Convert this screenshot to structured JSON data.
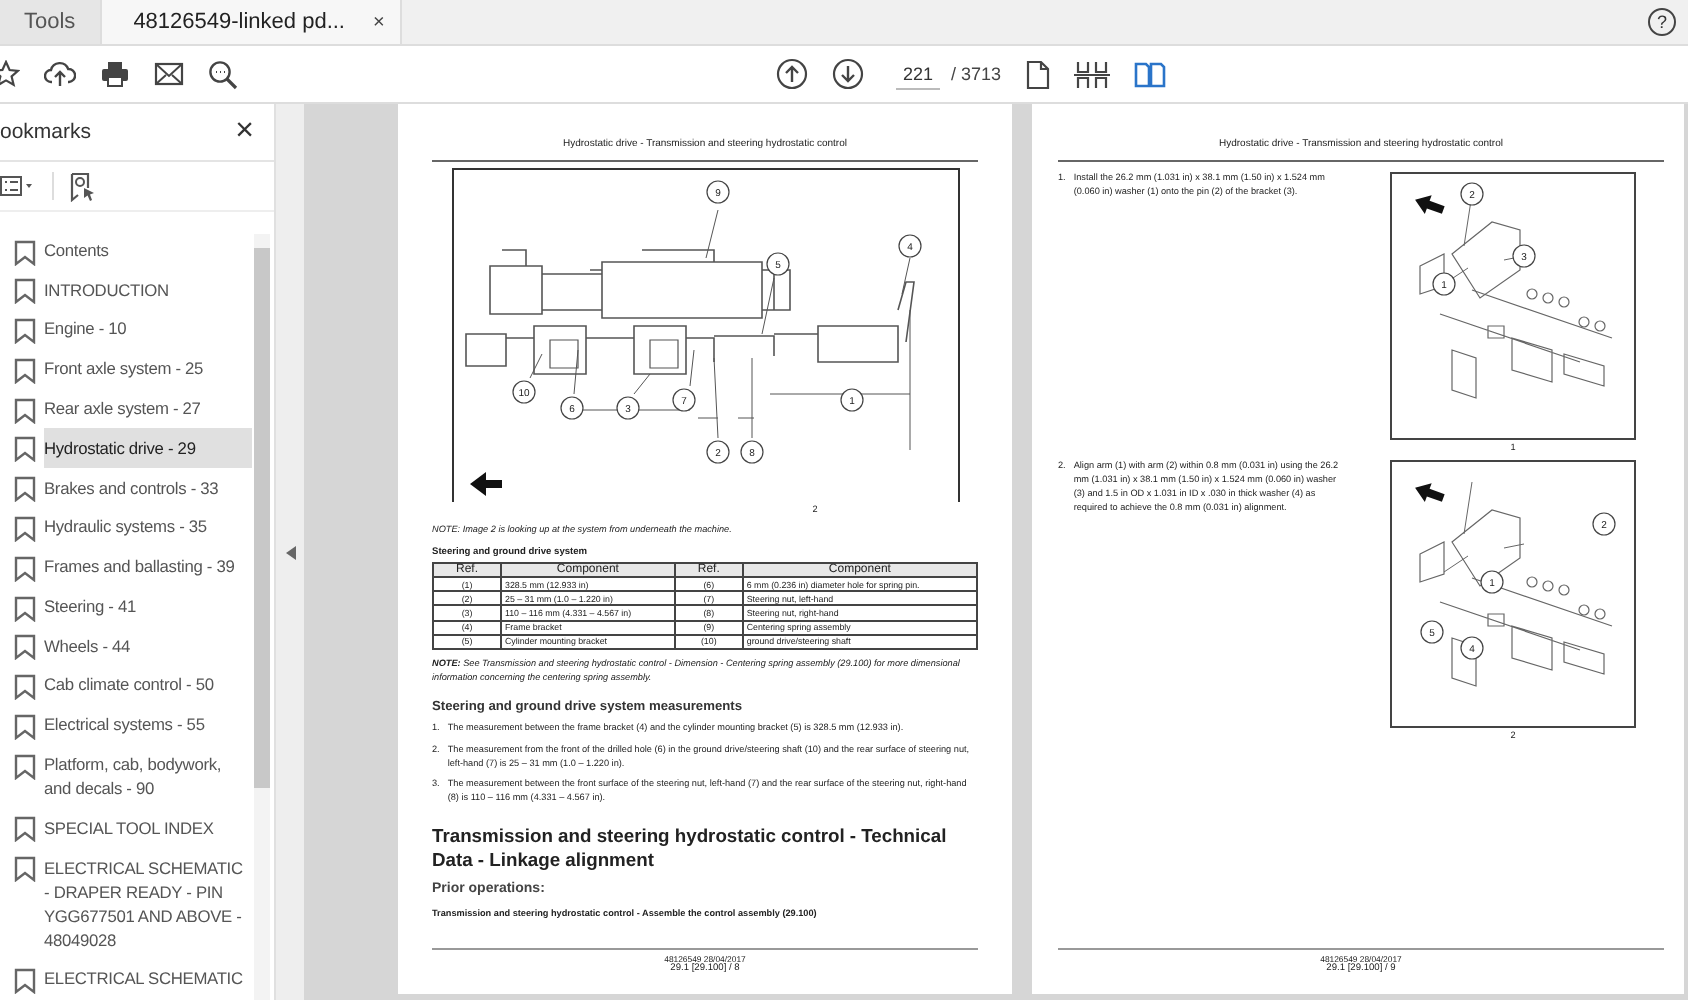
{
  "tabs": [
    {
      "label": "Tools",
      "selected": false
    },
    {
      "label": "48126549-linked pd...",
      "selected": true,
      "close": "×"
    }
  ],
  "help": "?",
  "toolbar": {
    "page_current": "221",
    "page_total": "/ 3713",
    "two_page_view": true
  },
  "bookmarks": {
    "title": "ookmarks",
    "close": "×",
    "items": [
      {
        "label": "Contents",
        "selected": false
      },
      {
        "label": "INTRODUCTION",
        "selected": false
      },
      {
        "label": "Engine - 10",
        "selected": false
      },
      {
        "label": "Front axle system - 25",
        "selected": false
      },
      {
        "label": "Rear axle system - 27",
        "selected": false
      },
      {
        "label": "Hydrostatic drive - 29",
        "selected": true
      },
      {
        "label": "Brakes and controls - 33",
        "selected": false
      },
      {
        "label": "Hydraulic systems - 35",
        "selected": false
      },
      {
        "label": "Frames and ballasting - 39",
        "selected": false
      },
      {
        "label": "Steering - 41",
        "selected": false
      },
      {
        "label": "Wheels - 44",
        "selected": false
      },
      {
        "label": "Cab climate control - 50",
        "selected": false
      },
      {
        "label": "Electrical systems - 55",
        "selected": false
      },
      {
        "label": "Platform, cab, bodywork, and decals - 90",
        "selected": false
      },
      {
        "label": "SPECIAL TOOL INDEX",
        "selected": false
      },
      {
        "label": "ELECTRICAL SCHEMATIC - DRAPER READY - PIN YGG677501 AND ABOVE - 48049028",
        "selected": false
      },
      {
        "label": "ELECTRICAL SCHEMATIC",
        "selected": false
      }
    ]
  },
  "left_page": {
    "header": "Hydrostatic drive - Transmission and steering hydrostatic control",
    "figure": {
      "caption": "2",
      "callouts": [
        "9",
        "5",
        "4",
        "10",
        "6",
        "3",
        "7",
        "1",
        "2",
        "8"
      ]
    },
    "note": "NOTE: Image 2 is looking up at the system from underneath the machine.",
    "table_title": "Steering and ground drive system",
    "table": {
      "columns": [
        "Ref.",
        "Component",
        "Ref.",
        "Component"
      ],
      "rows": [
        [
          "(1)",
          "328.5 mm (12.933 in)",
          "(6)",
          "6 mm (0.236 in) diameter hole for spring pin."
        ],
        [
          "(2)",
          "25 – 31 mm (1.0 – 1.220 in)",
          "(7)",
          "Steering nut, left-hand"
        ],
        [
          "(3)",
          "110 – 116 mm (4.331 – 4.567 in)",
          "(8)",
          "Steering nut, right-hand"
        ],
        [
          "(4)",
          "Frame bracket",
          "(9)",
          "Centering spring assembly"
        ],
        [
          "(5)",
          "Cylinder mounting bracket",
          "(10)",
          "ground drive/steering shaft"
        ]
      ]
    },
    "note_2": "**NOTE:** See Transmission and steering hydrostatic control - Dimension - Centering spring assembly (29.100) for more dimensional information concerning the centering spring assembly.",
    "section_heading": "Steering and ground drive system measurements",
    "measurements": [
      {
        "number": "1.",
        "text": "The measurement between the frame bracket (4) and the cylinder mounting bracket (5) is 328.5 mm (12.933 in)."
      },
      {
        "number": "2.",
        "text": "The measurement from the front of the drilled hole (6) in the ground drive/steering shaft (10) and the rear surface of steering nut, left-hand (7) is 25 – 31 mm (1.0 – 1.220 in)."
      },
      {
        "number": "3.",
        "text": "The measurement between the front surface of the steering nut, left-hand (7) and the rear surface of the steering nut, right-hand (8) is 110 – 116 mm (4.331 – 4.567 in)."
      }
    ],
    "main_heading": "Transmission and steering hydrostatic control - Technical Data - Linkage alignment",
    "sub_heading": "Prior operations:",
    "prior_operation": "Transmission and steering hydrostatic control - Assemble the control assembly (29.100)",
    "footer_doc": "48126549 28/04/2017",
    "footer_page": "29.1 [29.100] / 8"
  },
  "right_page": {
    "header": "Hydrostatic drive - Transmission and steering hydrostatic control",
    "steps": [
      {
        "number": "1.",
        "text": "Install the 26.2 mm (1.031 in) x 38.1 mm (1.50 in) x 1.524 mm (0.060 in) washer (1) onto the pin (2) of the bracket (3).",
        "caption": "1",
        "callouts": [
          "2",
          "3",
          "1"
        ]
      },
      {
        "number": "2.",
        "text": "Align arm (1) with arm (2) within 0.8 mm (0.031 in) using the 26.2 mm (1.031 in) x 38.1 mm (1.50 in) x 1.524 mm (0.060 in) washer (3) and 1.5 in OD x 1.031 in ID x .030 in thick washer (4) as required to achieve the 0.8 mm (0.031 in) alignment.",
        "caption": "2",
        "callouts": [
          "2",
          "1",
          "5",
          "4"
        ]
      }
    ],
    "footer_doc": "48126549 28/04/2017",
    "footer_page": "29.1 [29.100] / 9"
  }
}
